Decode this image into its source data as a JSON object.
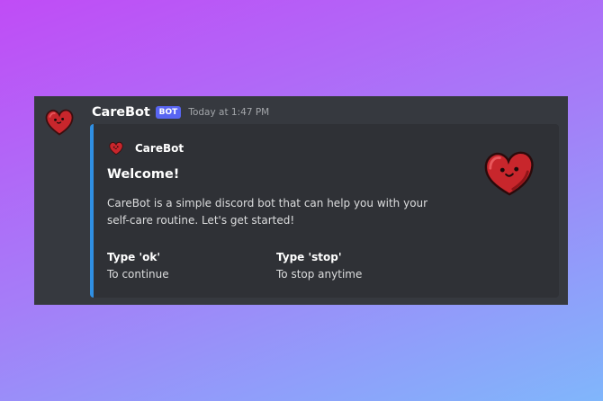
{
  "message": {
    "username": "CareBot",
    "badge": "BOT",
    "timestamp": "Today at 1:47 PM",
    "avatar_icon": "heart-face-icon"
  },
  "embed": {
    "accent_color": "#2f8fe3",
    "author": {
      "name": "CareBot",
      "icon": "heart-face-icon"
    },
    "title": "Welcome!",
    "description": "CareBot is a simple discord bot that can help you with your self-care routine. Let's get started!",
    "thumbnail_icon": "heart-face-icon",
    "fields": [
      {
        "name": "Type 'ok'",
        "value": "To continue"
      },
      {
        "name": "Type 'stop'",
        "value": "To stop anytime"
      }
    ]
  }
}
